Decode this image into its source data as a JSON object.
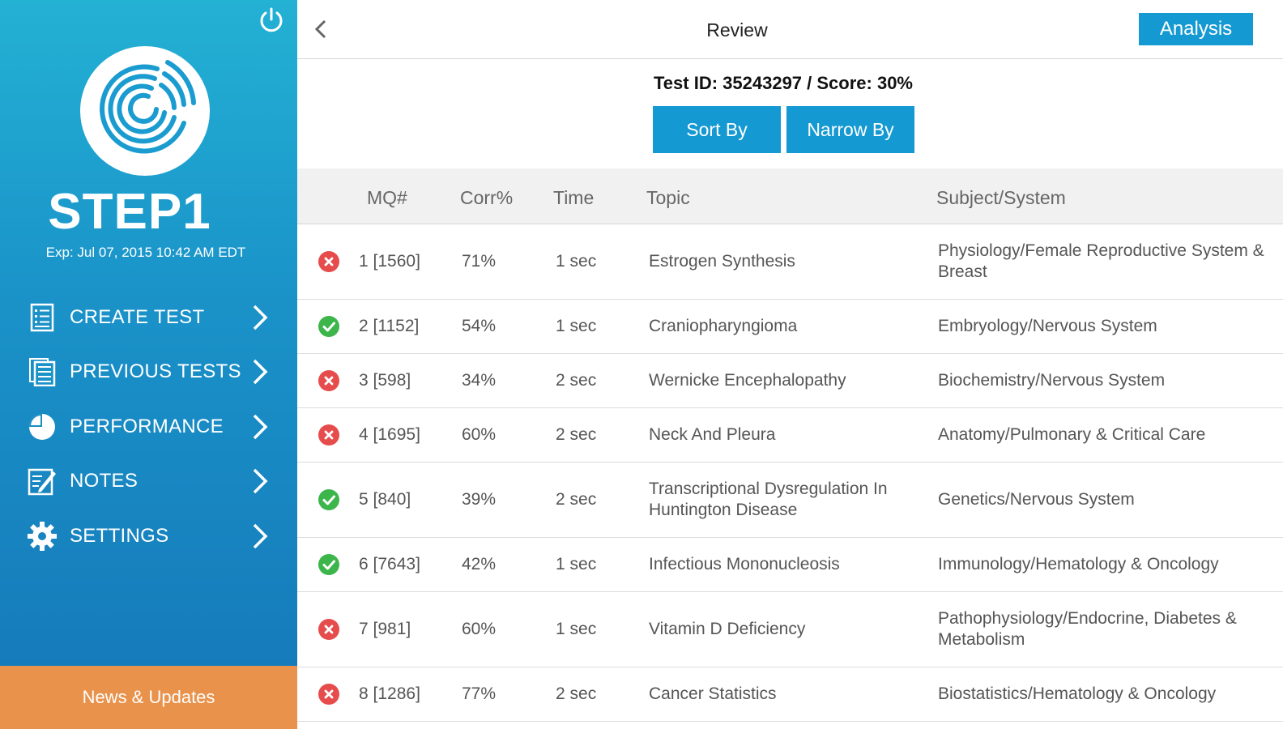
{
  "sidebar": {
    "brand": "STEP1",
    "expiry": "Exp: Jul 07, 2015 10:42 AM EDT",
    "power_icon": "power-icon",
    "items": [
      {
        "label": "CREATE TEST",
        "icon": "create-test-icon"
      },
      {
        "label": "PREVIOUS TESTS",
        "icon": "previous-tests-icon"
      },
      {
        "label": "PERFORMANCE",
        "icon": "pie-chart-icon"
      },
      {
        "label": "NOTES",
        "icon": "notes-icon"
      },
      {
        "label": "SETTINGS",
        "icon": "gear-icon"
      }
    ],
    "news_label": "News & Updates"
  },
  "header": {
    "title": "Review",
    "analysis_label": "Analysis"
  },
  "test_info": "Test ID: 35243297 / Score: 30%",
  "toolbar": {
    "sort_label": "Sort By",
    "narrow_label": "Narrow By"
  },
  "table": {
    "columns": [
      "MQ#",
      "Corr%",
      "Time",
      "Topic",
      "Subject/System"
    ],
    "rows": [
      {
        "status": "incorrect",
        "mq": "1 [1560]",
        "corr": "71%",
        "time": "1 sec",
        "topic": "Estrogen Synthesis",
        "subject": "Physiology/Female Reproductive System & Breast"
      },
      {
        "status": "correct",
        "mq": "2 [1152]",
        "corr": "54%",
        "time": "1 sec",
        "topic": "Craniopharyngioma",
        "subject": "Embryology/Nervous System"
      },
      {
        "status": "incorrect",
        "mq": "3 [598]",
        "corr": "34%",
        "time": "2 sec",
        "topic": "Wernicke Encephalopathy",
        "subject": "Biochemistry/Nervous System"
      },
      {
        "status": "incorrect",
        "mq": "4 [1695]",
        "corr": "60%",
        "time": "2 sec",
        "topic": "Neck And Pleura",
        "subject": "Anatomy/Pulmonary & Critical Care"
      },
      {
        "status": "correct",
        "mq": "5 [840]",
        "corr": "39%",
        "time": "2 sec",
        "topic": "Transcriptional Dysregulation In Huntington Disease",
        "subject": "Genetics/Nervous System"
      },
      {
        "status": "correct",
        "mq": "6 [7643]",
        "corr": "42%",
        "time": "1 sec",
        "topic": "Infectious Mononucleosis",
        "subject": "Immunology/Hematology & Oncology"
      },
      {
        "status": "incorrect",
        "mq": "7 [981]",
        "corr": "60%",
        "time": "1 sec",
        "topic": "Vitamin D Deficiency",
        "subject": "Pathophysiology/Endocrine, Diabetes & Metabolism"
      },
      {
        "status": "incorrect",
        "mq": "8 [1286]",
        "corr": "77%",
        "time": "2 sec",
        "topic": "Cancer Statistics",
        "subject": "Biostatistics/Hematology & Oncology"
      }
    ]
  },
  "colors": {
    "accent": "#1599d2",
    "news": "#e8924b",
    "correct": "#3cb54a",
    "incorrect": "#e74c4c"
  }
}
